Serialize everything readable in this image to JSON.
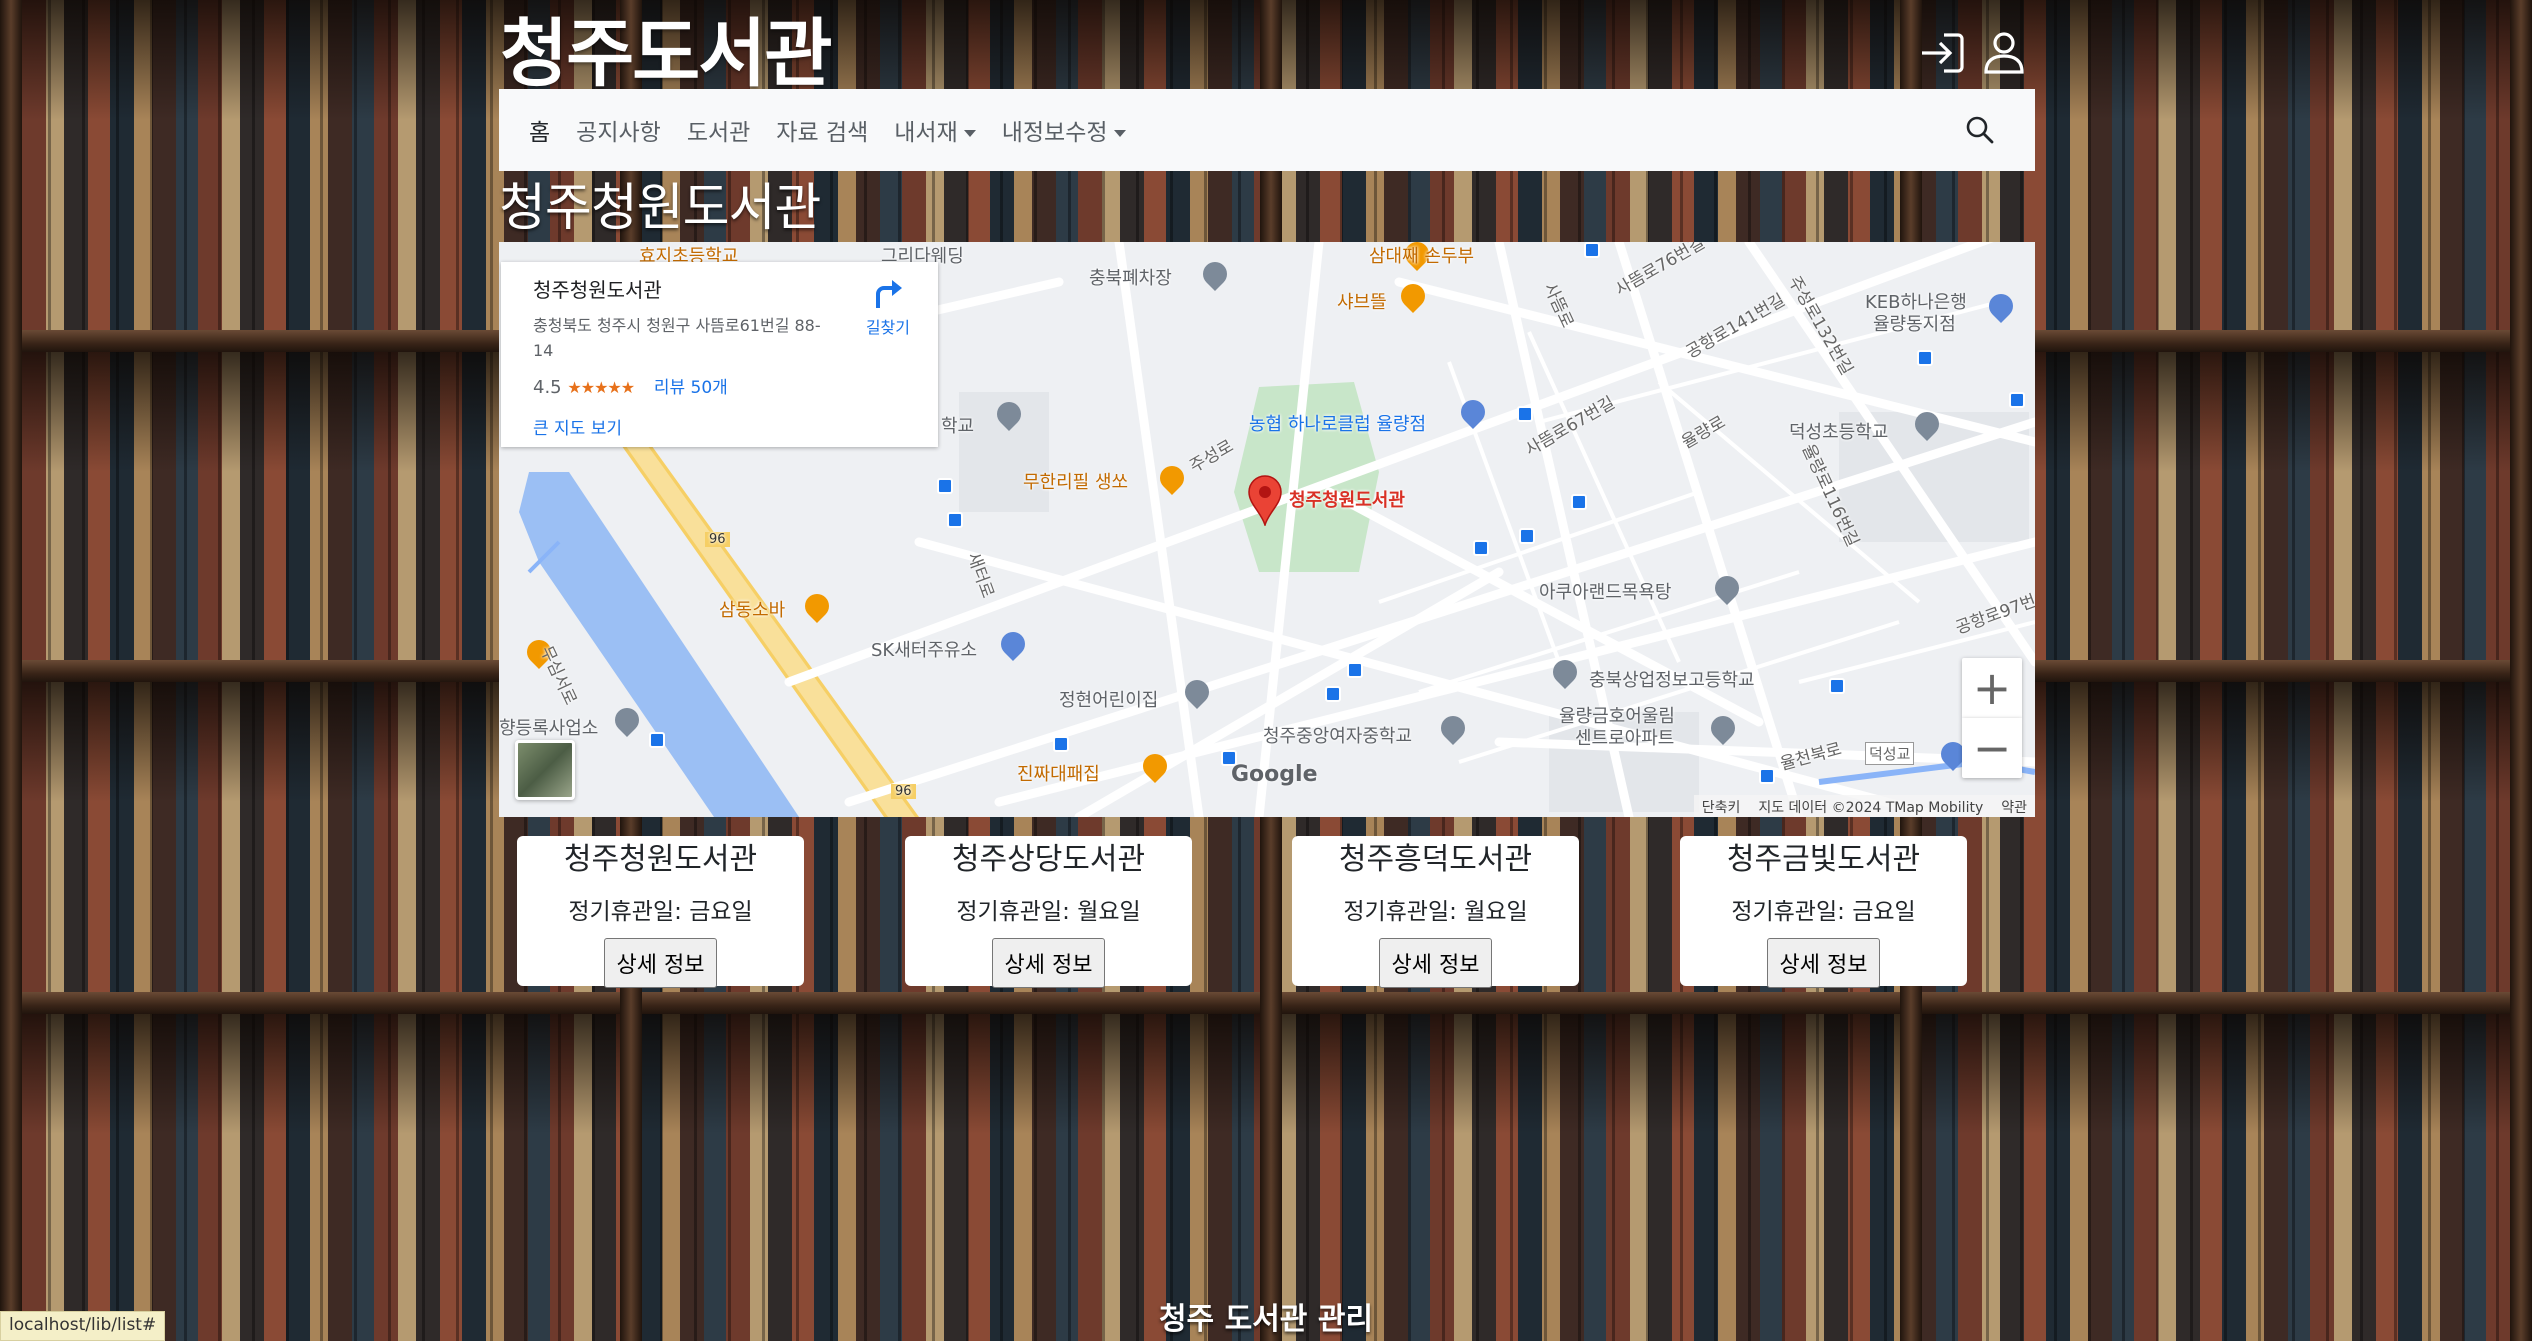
{
  "site": {
    "title": "청주도서관",
    "login_icon": "login-icon",
    "user_icon": "user-icon"
  },
  "nav": {
    "items": [
      {
        "label": "홈",
        "active": true,
        "dropdown": false
      },
      {
        "label": "공지사항",
        "active": false,
        "dropdown": false
      },
      {
        "label": "도서관",
        "active": false,
        "dropdown": false
      },
      {
        "label": "자료 검색",
        "active": false,
        "dropdown": false
      },
      {
        "label": "내서재",
        "active": false,
        "dropdown": true
      },
      {
        "label": "내정보수정",
        "active": false,
        "dropdown": true
      }
    ],
    "search_icon": "search-icon"
  },
  "library_heading": "청주청원도서관",
  "map": {
    "info": {
      "name": "청주청원도서관",
      "address": "충청북도 청주시 청원구 사뜸로61번길 88-14",
      "rating": "4.5",
      "stars": "★★★★★",
      "reviews": "리뷰 50개",
      "big_map": "큰 지도 보기",
      "directions": "길찾기"
    },
    "labels": {
      "chungbuk_parking": "충북폐차장",
      "sabre": "샤브뜰",
      "nonghyup": "농협 하나로클럽 율량점",
      "keb_1": "KEB하나은행",
      "keb_2": "율량동지점",
      "deokseong": "덕성초등학교",
      "muhan": "무한리필 생쏘",
      "jusung": "주성로",
      "marker": "청주청원도서관",
      "samdong": "삼동소바",
      "sk": "SK새터주유소",
      "aqua": "아쿠아랜드목욕탕",
      "chungbuk_school": "충북상업정보고등학교",
      "junghyeon": "정현어린이집",
      "yulryang_apt_1": "율량금호어울림",
      "yulryang_apt_2": "센트로아파트",
      "cheongju_girls": "청주중앙여자중학교",
      "jinjja": "진짜대패집",
      "yangdong": "향등록사업소",
      "sadeum": "사뜸로",
      "sadeum76": "사뜸로76번길",
      "gongnyang141": "공항로141번길",
      "juseong132": "주성로132번길",
      "juseong67": "사뜸로67번길",
      "yulryangro": "율량로",
      "deokseong_116": "율량로116번길",
      "gonghang97": "공항로97번",
      "yulcheon": "율천북로",
      "deokseonggyo": "덕성교",
      "sae": "새터로",
      "musim": "무심서로",
      "top_hakwon": "효지초등학교",
      "top_wedding": "그리다웨딩",
      "top_samdae": "삼대째 손두부",
      "school_left": "학교",
      "road_96": "96",
      "google": "Google"
    },
    "footer": {
      "shortcut": "단축키",
      "data": "지도 데이터 ©2024 TMap Mobility",
      "terms": "약관"
    },
    "zoom_in": "+",
    "zoom_out": "−"
  },
  "libraries": [
    {
      "name": "청주청원도서관",
      "closed": "정기휴관일: 금요일",
      "button": "상세 정보"
    },
    {
      "name": "청주상당도서관",
      "closed": "정기휴관일: 월요일",
      "button": "상세 정보"
    },
    {
      "name": "청주흥덕도서관",
      "closed": "정기휴관일: 월요일",
      "button": "상세 정보"
    },
    {
      "name": "청주금빛도서관",
      "closed": "정기휴관일: 금요일",
      "button": "상세 정보"
    }
  ],
  "footer": {
    "text": "청주 도서관 관리"
  },
  "status_url": "localhost/lib/list#",
  "colors": {
    "nav_bg": "#f8f9fa",
    "map_bg": "#eef0f3",
    "marker_red": "#ea4335",
    "road_yellow": "#f6cf65",
    "water_blue": "#9bbff4",
    "park_green": "#c8e6c9"
  }
}
